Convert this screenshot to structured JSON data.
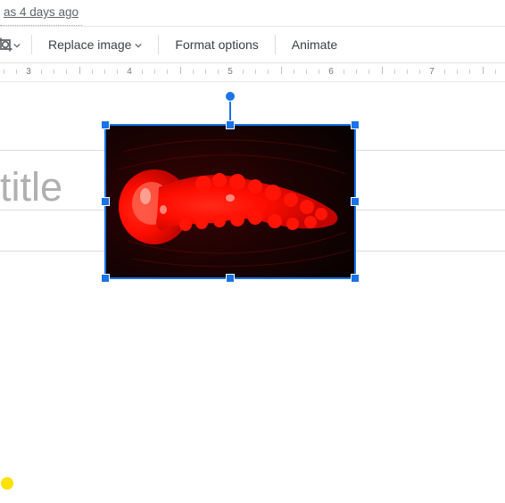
{
  "header": {
    "last_edit_text": "as 4 days ago"
  },
  "toolbar": {
    "replace_image": "Replace image",
    "format_options": "Format options",
    "animate": "Animate"
  },
  "ruler": {
    "numbers": [
      "3",
      "4",
      "5",
      "6",
      "7"
    ]
  },
  "slide": {
    "placeholder_text": "title",
    "selected_image_desc": "jellyfish-red"
  },
  "selection": {
    "color": "#1a73e8"
  }
}
